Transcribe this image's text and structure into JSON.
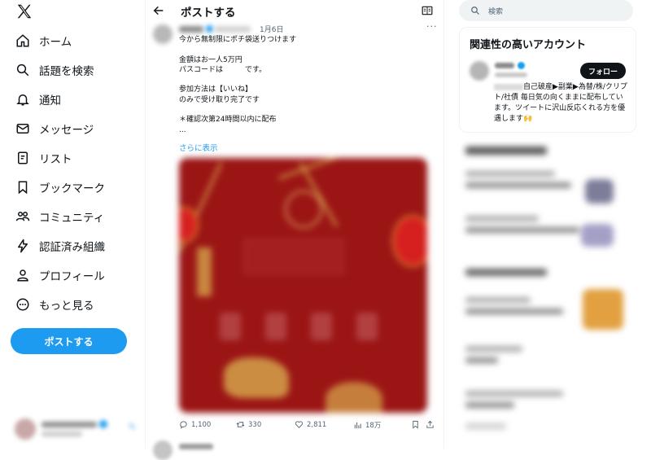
{
  "app": {
    "logo": "x-logo-icon"
  },
  "nav": {
    "items": [
      {
        "label": "ホーム",
        "icon": "home-icon"
      },
      {
        "label": "話題を検索",
        "icon": "search-icon"
      },
      {
        "label": "通知",
        "icon": "bell-icon"
      },
      {
        "label": "メッセージ",
        "icon": "envelope-icon"
      },
      {
        "label": "リスト",
        "icon": "list-icon"
      },
      {
        "label": "ブックマーク",
        "icon": "bookmark-icon"
      },
      {
        "label": "コミュニティ",
        "icon": "people-icon"
      },
      {
        "label": "認証済み組織",
        "icon": "lightning-icon"
      },
      {
        "label": "プロフィール",
        "icon": "person-icon"
      },
      {
        "label": "もっと見る",
        "icon": "more-circle-icon"
      }
    ],
    "post_button": "ポストする"
  },
  "main": {
    "title": "ポストする",
    "tweet": {
      "date": "1月6日",
      "lines": [
        "今から無制限にポチ袋送りつけます",
        "",
        "金額はお一人5万円",
        "パスコードは　　　です。",
        "",
        "参加方法は【いいね】",
        "のみで受け取り完了です",
        "",
        "＊確認次第24時間以内に配布",
        "..."
      ],
      "show_more": "さらに表示",
      "actions": {
        "reply": "1,100",
        "retweet": "330",
        "like": "2,811",
        "views": "18万"
      }
    }
  },
  "right": {
    "search_placeholder": "検索",
    "card": {
      "title": "関連性の高いアカウント",
      "follow_label": "フォロー",
      "bio": "自己破産▶副業▶為替/株/クリプト/社債 毎日気の向くままに配布しています。ツイートに沢山反応くれる方を優遇します🙌"
    }
  },
  "colors": {
    "accent": "#1d9bf0",
    "text": "#0f1419",
    "muted": "#536471",
    "media_bg": "#9b1515"
  }
}
